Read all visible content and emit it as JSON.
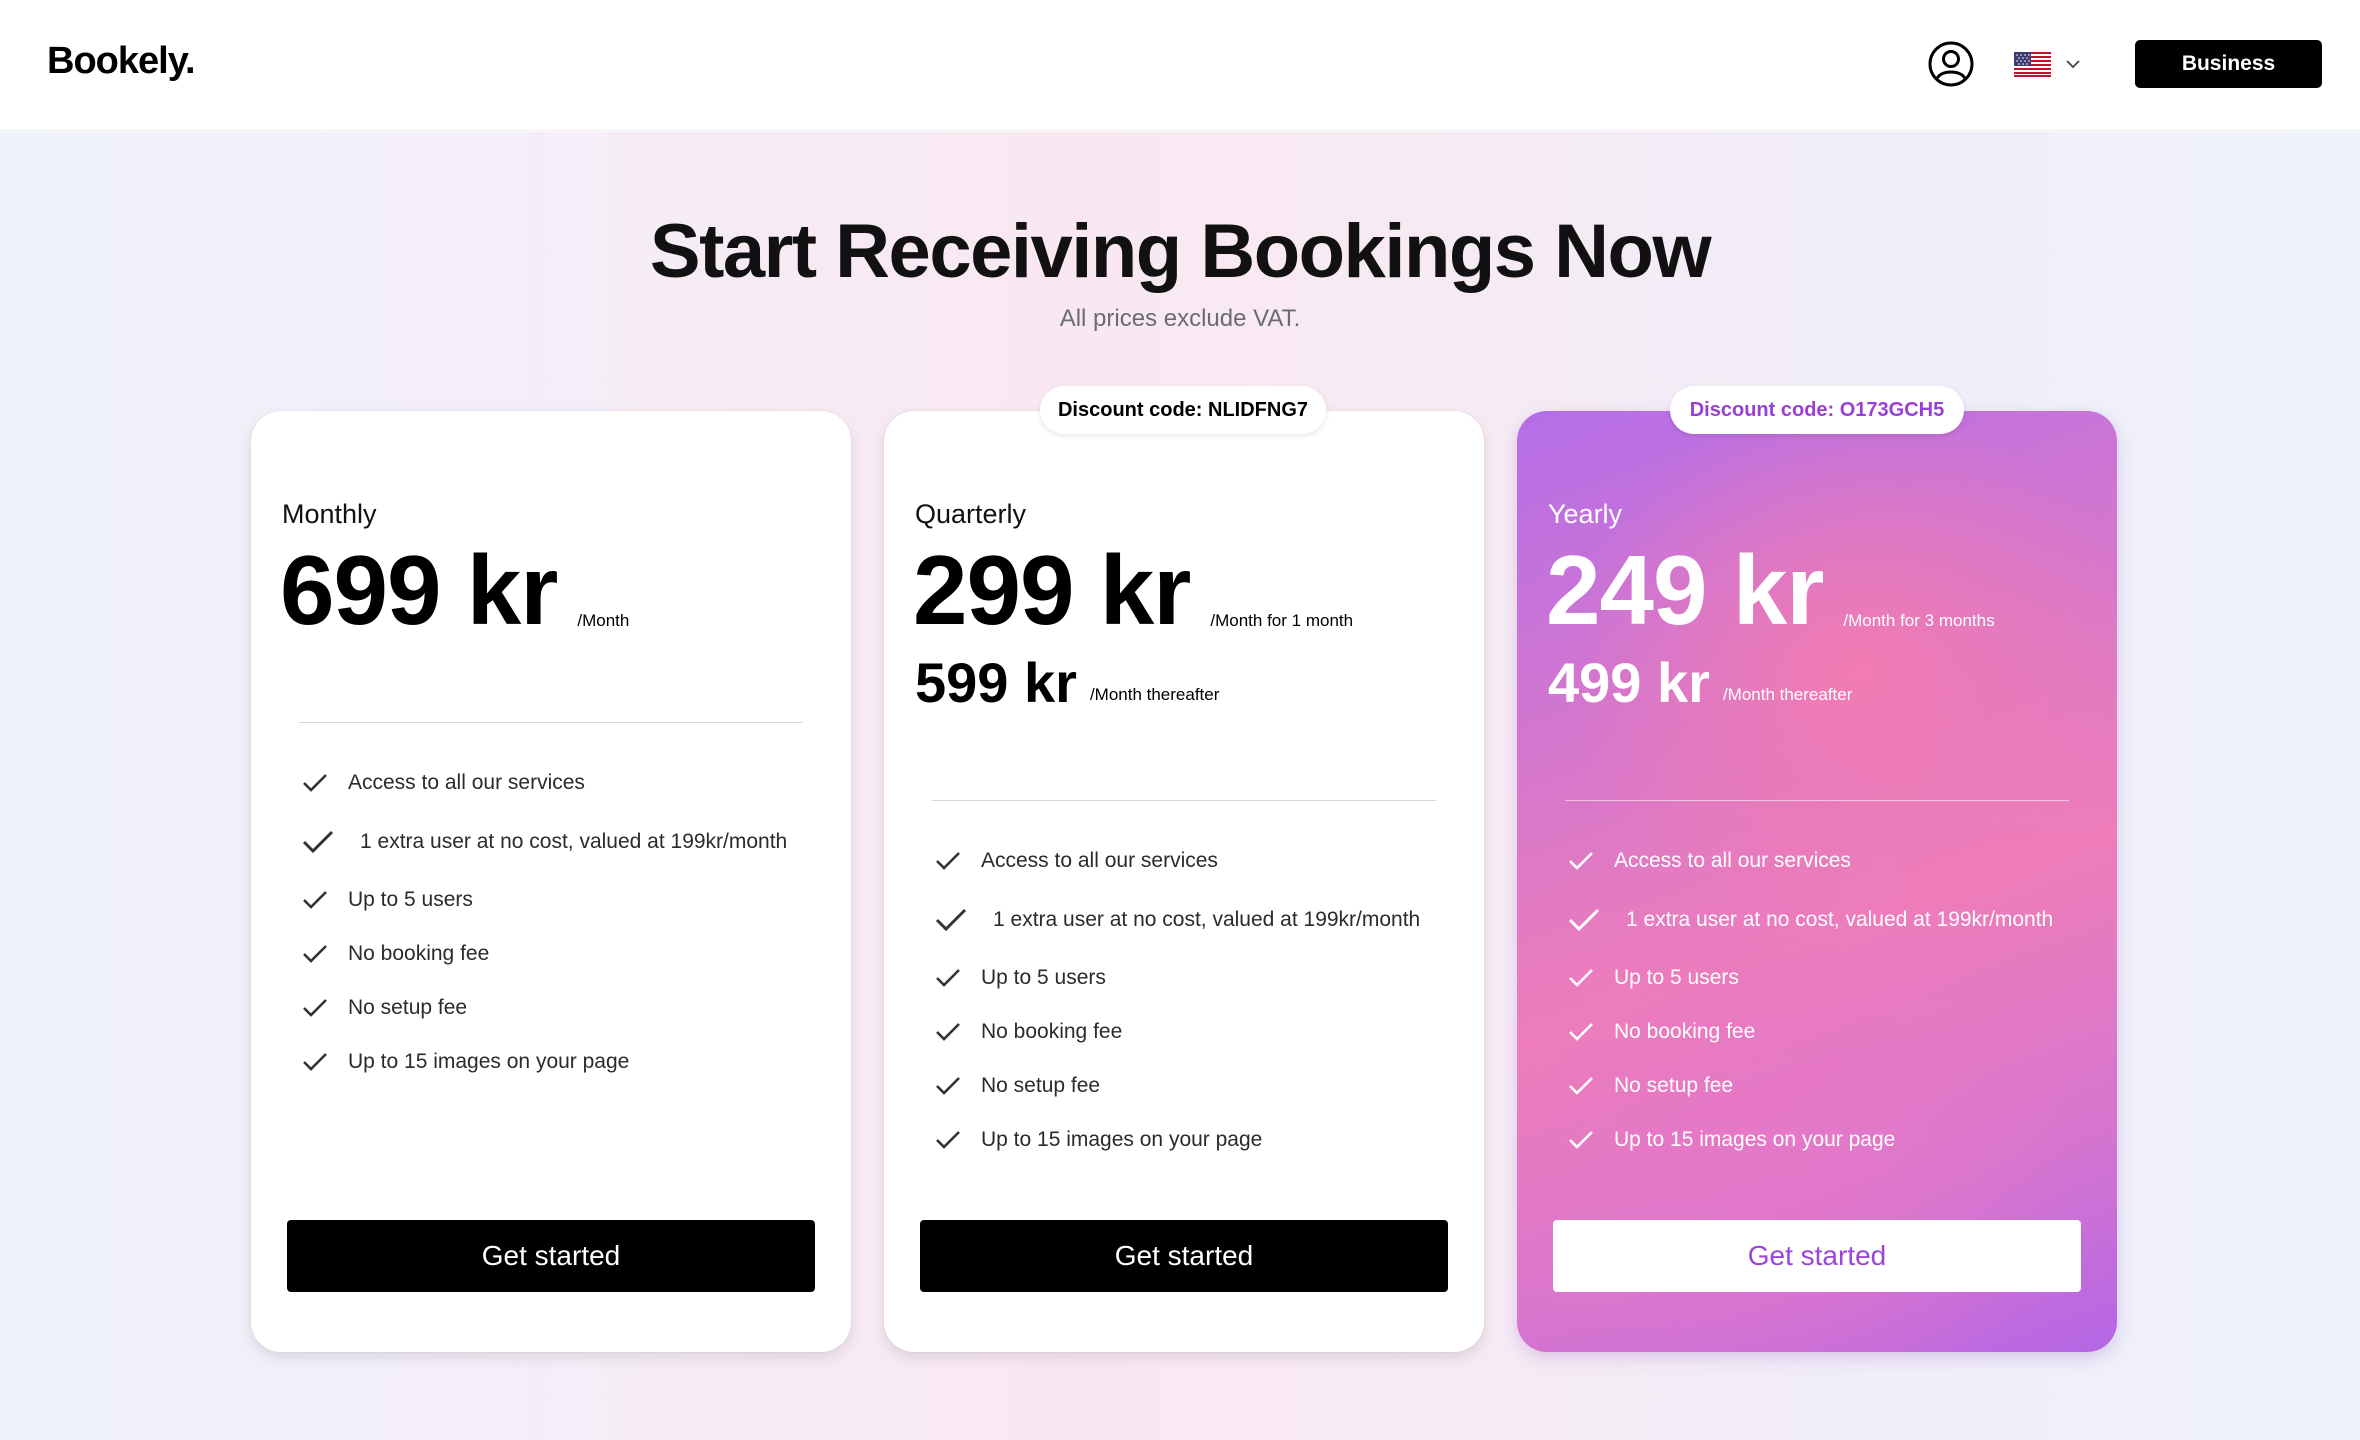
{
  "header": {
    "logo": "Bookely.",
    "user_icon": "user-circle-icon",
    "language_flag": "us-flag-icon",
    "business_label": "Business"
  },
  "hero": {
    "title": "Start Receiving Bookings Now",
    "subtitle": "All prices exclude VAT."
  },
  "plans": [
    {
      "name": "Monthly",
      "discount_code": "",
      "price": "699 kr",
      "price_note": "/Month",
      "price_after": "",
      "price_after_note": "",
      "features": [
        "Access to all our services",
        "1 extra user at no cost, valued at 199kr/month",
        "Up to 5 users",
        "No booking fee",
        "No setup fee",
        "Up to 15 images on your page"
      ],
      "cta": "Get started"
    },
    {
      "name": "Quarterly",
      "discount_code": "Discount code: NLIDFNG7",
      "price": "299 kr",
      "price_note": "/Month for 1 month",
      "price_after": "599 kr",
      "price_after_note": "/Month thereafter",
      "features": [
        "Access to all our services",
        "1 extra user at no cost, valued at 199kr/month",
        "Up to 5 users",
        "No booking fee",
        "No setup fee",
        "Up to 15 images on your page"
      ],
      "cta": "Get started"
    },
    {
      "name": "Yearly",
      "discount_code": "Discount code: O173GCH5",
      "price": "249 kr",
      "price_note": "/Month for 3 months",
      "price_after": "499 kr",
      "price_after_note": "/Month thereafter",
      "features": [
        "Access to all our services",
        "1 extra user at no cost, valued at 199kr/month",
        "Up to 5 users",
        "No booking fee",
        "No setup fee",
        "Up to 15 images on your page"
      ],
      "cta": "Get started"
    }
  ],
  "colors": {
    "accent_purple": "#9a3fd6",
    "highlight_gradient_start": "#b56ee8",
    "highlight_gradient_mid": "#ee7db9",
    "button_dark": "#000000"
  }
}
